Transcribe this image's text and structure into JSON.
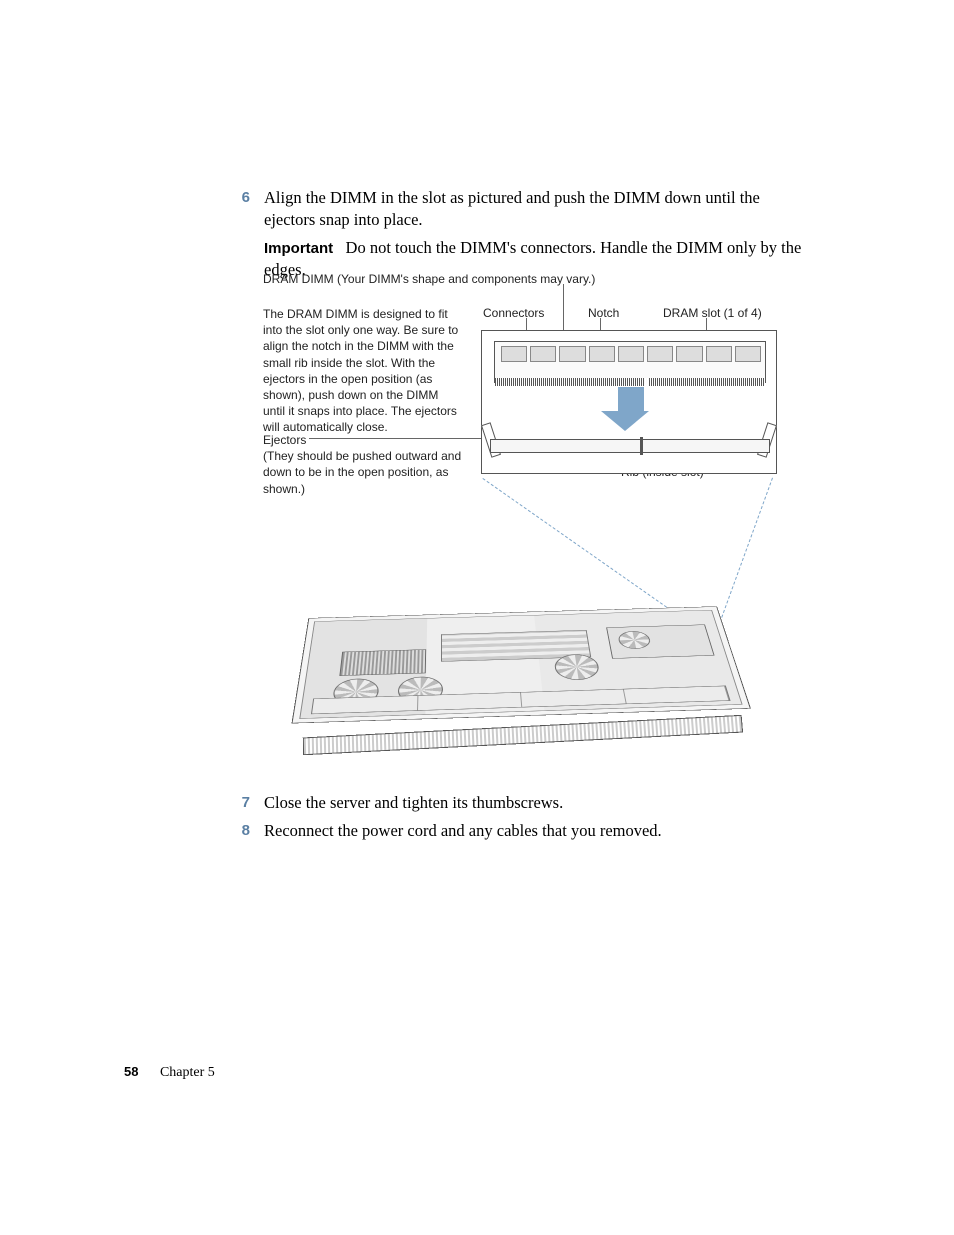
{
  "steps": {
    "s6": {
      "num": "6",
      "text": "Align the DIMM in the slot as pictured and push the DIMM down until the ejectors snap into place."
    },
    "s7": {
      "num": "7",
      "text": "Close the server and tighten its thumbscrews."
    },
    "s8": {
      "num": "8",
      "text": "Reconnect the power cord and any cables that you removed."
    }
  },
  "important": {
    "label": "Important",
    "text": "Do not touch the DIMM's connectors. Handle the DIMM only by the edges."
  },
  "figure": {
    "title": "DRAM DIMM (Your DIMM's shape and components may vary.)",
    "instructions": "The DRAM DIMM is designed to fit into the slot only one way. Be sure to align the notch in the DIMM with the small rib inside the slot. With the ejectors in the open position (as shown), push down on the DIMM until it snaps into place. The ejectors will automatically close.",
    "labels": {
      "connectors": "Connectors",
      "notch": "Notch",
      "dram_slot": "DRAM slot (1 of 4)",
      "ejectors_title": "Ejectors",
      "ejectors_note": "(They should be pushed outward and down to be in the open position, as shown.)",
      "rib": "Rib (inside slot)"
    }
  },
  "footer": {
    "page_number": "58",
    "chapter": "Chapter 5"
  }
}
